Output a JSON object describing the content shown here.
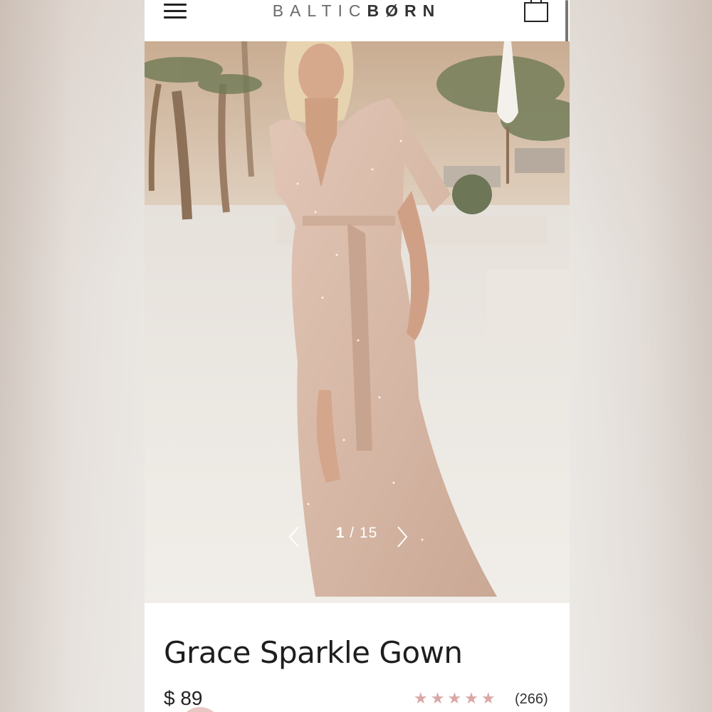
{
  "header": {
    "brand": "BALTIC",
    "brand_suffix": "BØRN",
    "menu_icon": "hamburger-menu-icon",
    "cart_icon": "shopping-bag-icon"
  },
  "gallery": {
    "current": "1",
    "separator": " / ",
    "total": "15",
    "prev_icon": "chevron-left-icon",
    "next_icon": "chevron-right-icon",
    "image_subject": "model wearing blush sparkle wrap maxi gown outdoors"
  },
  "product": {
    "title": "Grace Sparkle Gown",
    "price": "$ 89",
    "rating": 5,
    "stars": "★★★★★",
    "reviews": "(266)"
  },
  "colors": {
    "star": "#d9a7a5",
    "accent": "#e7c8c4"
  }
}
